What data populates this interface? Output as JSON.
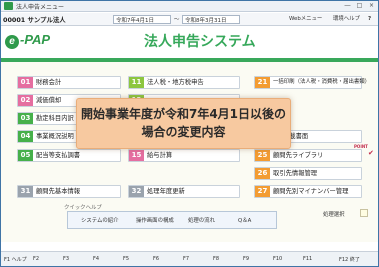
{
  "window": {
    "title": "法人申告メニュー",
    "controls": [
      "―",
      "□",
      "×"
    ]
  },
  "company": {
    "code_name": "00001 サンプル法人",
    "period_start_label": "令和7年4月1日",
    "period_end_label": "令和8年3月31日",
    "tilde": "～"
  },
  "toolbar": {
    "web_menu": "Webメニュー",
    "help": "環境ヘルプ",
    "icon_label": "?"
  },
  "logo": {
    "mark": "e",
    "text": "-PAP"
  },
  "system_title": "法人申告システム",
  "menu_left": [
    {
      "num": "01",
      "label": "財務会計"
    },
    {
      "num": "02",
      "label": "減価償却"
    },
    {
      "num": "03",
      "label": "勘定科目内訳"
    },
    {
      "num": "04",
      "label": "事業概況説明"
    },
    {
      "num": "05",
      "label": "配当等支払調書"
    }
  ],
  "menu_mid": [
    {
      "num": "11",
      "label": "法人税・地方税申告"
    },
    {
      "num": "12",
      "label": ""
    },
    {
      "num": "13",
      "label": ""
    },
    {
      "num": "14",
      "label": ""
    },
    {
      "num": "15",
      "label": "給与計算"
    }
  ],
  "menu_right": [
    {
      "num": "21",
      "label": "一括印刷（法人税・消費税・届出書類）"
    },
    {
      "num": "22",
      "label": ""
    },
    {
      "num": "23",
      "label": ""
    },
    {
      "num": "24",
      "label": "02 記載書面"
    },
    {
      "num": "25",
      "label": "顧問先ライブラリ"
    },
    {
      "num": "26",
      "label": "取引先情報管理"
    },
    {
      "num": "27",
      "label": "顧問先別マイナンバー管理"
    }
  ],
  "bottom_buttons": [
    {
      "num": "31",
      "label": "顧問先基本情報"
    },
    {
      "num": "32",
      "label": "処理年度更新"
    }
  ],
  "overlay": {
    "line1": "開始事業年度が令和7年4月1日以後の",
    "line2": "場合の変更内容"
  },
  "quick_help": {
    "title": "クイックヘルプ",
    "buttons": [
      "システムの紹介",
      "操作画面の構成",
      "処理の流れ",
      "Q＆A"
    ]
  },
  "process_select_label": "処理選択",
  "fkeys": [
    "F1",
    "F2",
    "F3",
    "F4",
    "F5",
    "F6",
    "F7",
    "F8",
    "F9",
    "F10",
    "F11",
    "F12"
  ],
  "fkey_labels": {
    "F1": "ヘルプ",
    "F12": "終了"
  },
  "new_badge": "POINT"
}
